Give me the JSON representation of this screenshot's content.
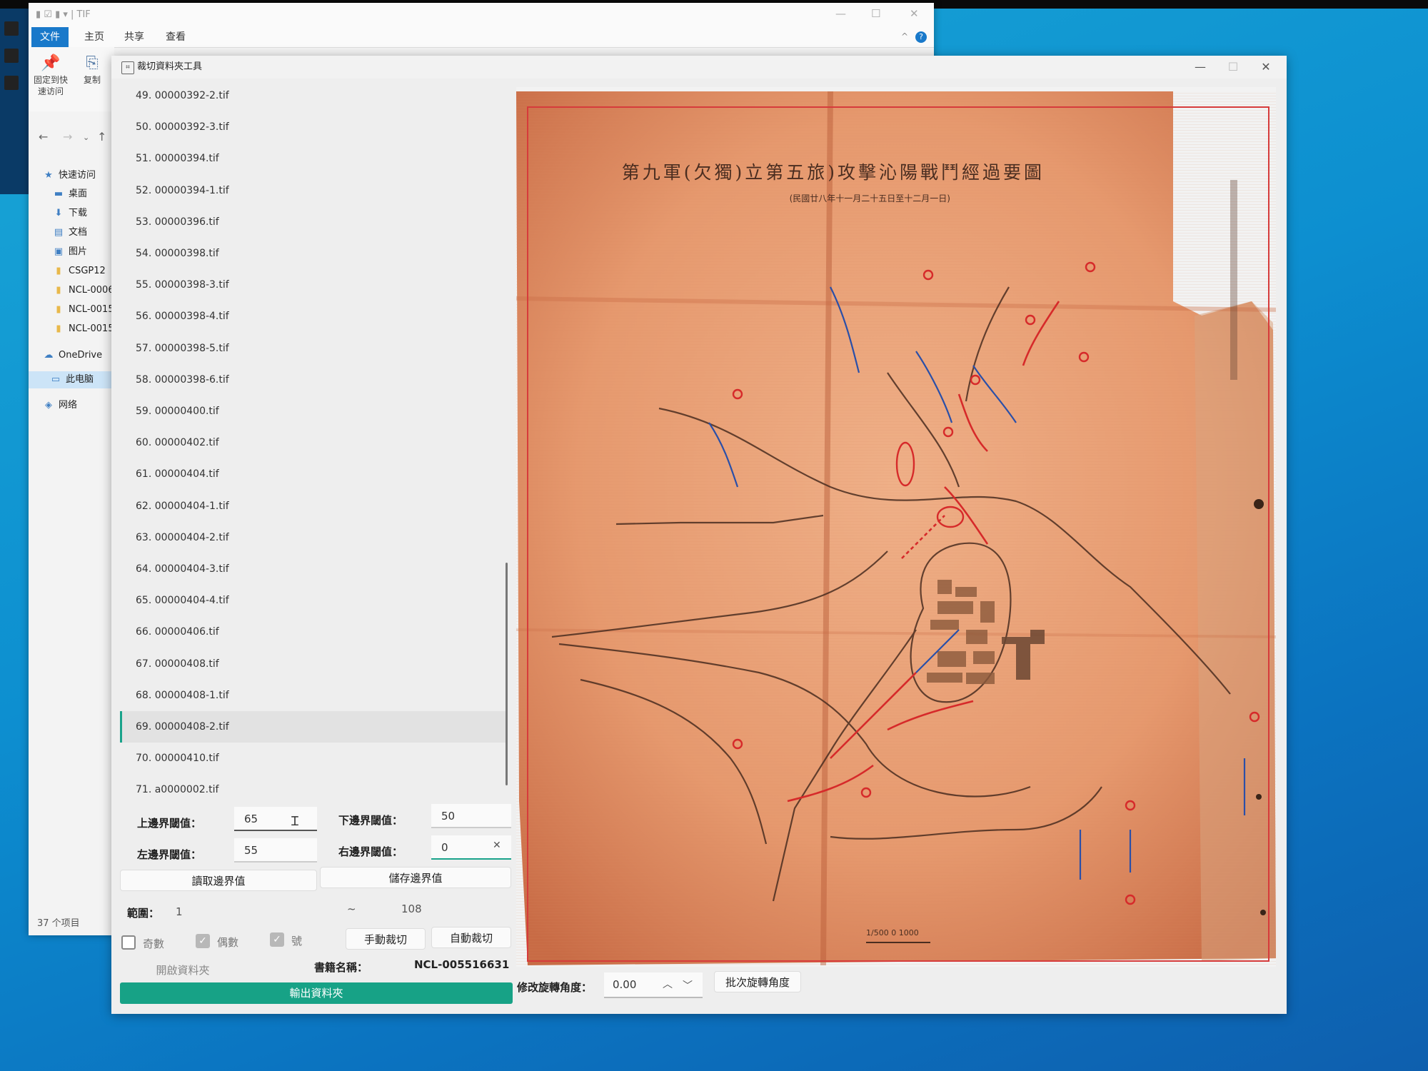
{
  "explorer": {
    "title": "TIF",
    "tabs": [
      "文件",
      "主页",
      "共享",
      "查看"
    ],
    "ribbon": {
      "pin_label": "固定到快\n速访问",
      "copy_label": "复制"
    },
    "tree": [
      "快速访问",
      "桌面",
      "下载",
      "文档",
      "图片",
      "CSGP12",
      "NCL-0006",
      "NCL-0015",
      "NCL-0015",
      "OneDrive",
      "此电脑",
      "网络"
    ],
    "status": "37 个项目"
  },
  "tool": {
    "title": "裁切資料夾工具",
    "files": [
      "49. 00000392-2.tif",
      "50. 00000392-3.tif",
      "51. 00000394.tif",
      "52. 00000394-1.tif",
      "53. 00000396.tif",
      "54. 00000398.tif",
      "55. 00000398-3.tif",
      "56. 00000398-4.tif",
      "57. 00000398-5.tif",
      "58. 00000398-6.tif",
      "59. 00000400.tif",
      "60. 00000402.tif",
      "61. 00000404.tif",
      "62. 00000404-1.tif",
      "63. 00000404-2.tif",
      "64. 00000404-3.tif",
      "65. 00000404-4.tif",
      "66. 00000406.tif",
      "67. 00000408.tif",
      "68. 00000408-1.tif",
      "69. 00000408-2.tif",
      "70. 00000410.tif",
      "71. a0000002.tif"
    ],
    "selected_file": "69. 00000408-2.tif",
    "form": {
      "top_label": "上邊界閾值：",
      "top_value": "65",
      "bottom_label": "下邊界閾值：",
      "bottom_value": "50",
      "left_label": "左邊界閾值：",
      "left_value": "55",
      "right_label": "右邊界閾值：",
      "right_value": "0",
      "read_btn": "讀取邊界值",
      "save_btn": "儲存邊界值",
      "range_label": "範圍：",
      "range_from": "1",
      "range_sep": "~",
      "range_to": "108",
      "odd_label": "奇數",
      "even_label": "偶數",
      "num_label": "號",
      "manual_btn": "手動裁切",
      "auto_btn": "自動裁切",
      "open_btn": "開啟資料夾",
      "book_label": "書籍名稱：",
      "book_value": "NCL-005516631",
      "output_btn": "輸出資料夾",
      "rotate_label": "修改旋轉角度：",
      "rotate_value": "0.00",
      "batch_btn": "批次旋轉角度"
    }
  },
  "map": {
    "title": "第九軍(欠獨)立第五旅)攻擊沁陽戰鬥經過要圖",
    "subtitle": "(民國廿八年十一月二十五日至十二月一日)",
    "scale_text": "1/500 0 1000",
    "colors": {
      "paper": "#e59770",
      "frame": "#d63b3b",
      "ink_red": "#d62a2a",
      "ink_blue": "#2a4fa8",
      "ink_dark": "#4a2d20"
    }
  }
}
